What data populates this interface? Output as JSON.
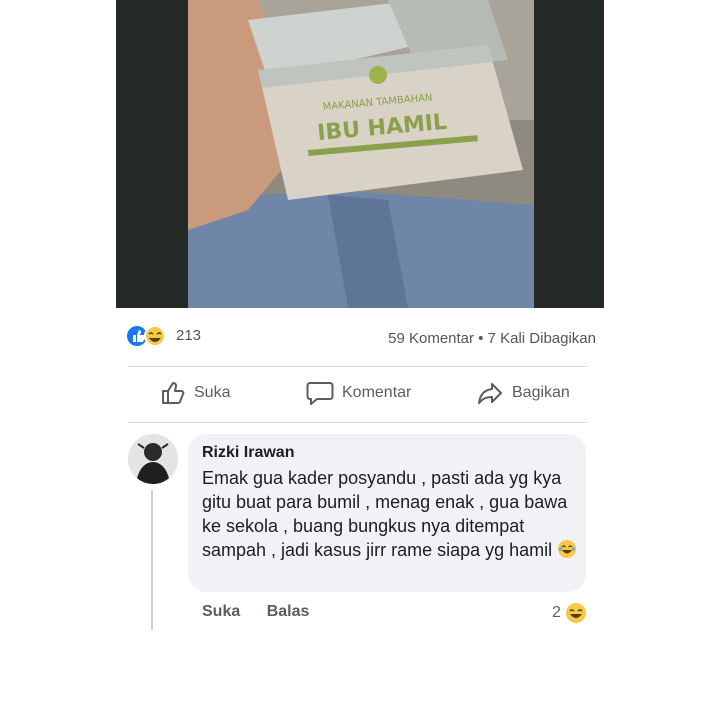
{
  "post": {
    "photo": {
      "package_line1": "MAKANAN TAMBAHAN",
      "package_line2": "IBU HAMIL"
    },
    "reaction_count": "213",
    "stats_text": "59 Komentar • 7 Kali Dibagikan",
    "actions": {
      "like_label": "Suka",
      "comment_label": "Komentar",
      "share_label": "Bagikan"
    }
  },
  "comment": {
    "author": "Rizki Irawan",
    "text": "Emak gua kader posyandu , pasti ada yg kya gitu buat para bumil , menag enak , gua bawa ke sekola , buang bungkus nya ditempat sampah , jadi kasus jirr rame siapa yg hamil",
    "like_label": "Suka",
    "reply_label": "Balas",
    "reaction_count": "2"
  },
  "colors": {
    "like_blue": "#1877f2",
    "haha_yellow": "#f7c948"
  }
}
